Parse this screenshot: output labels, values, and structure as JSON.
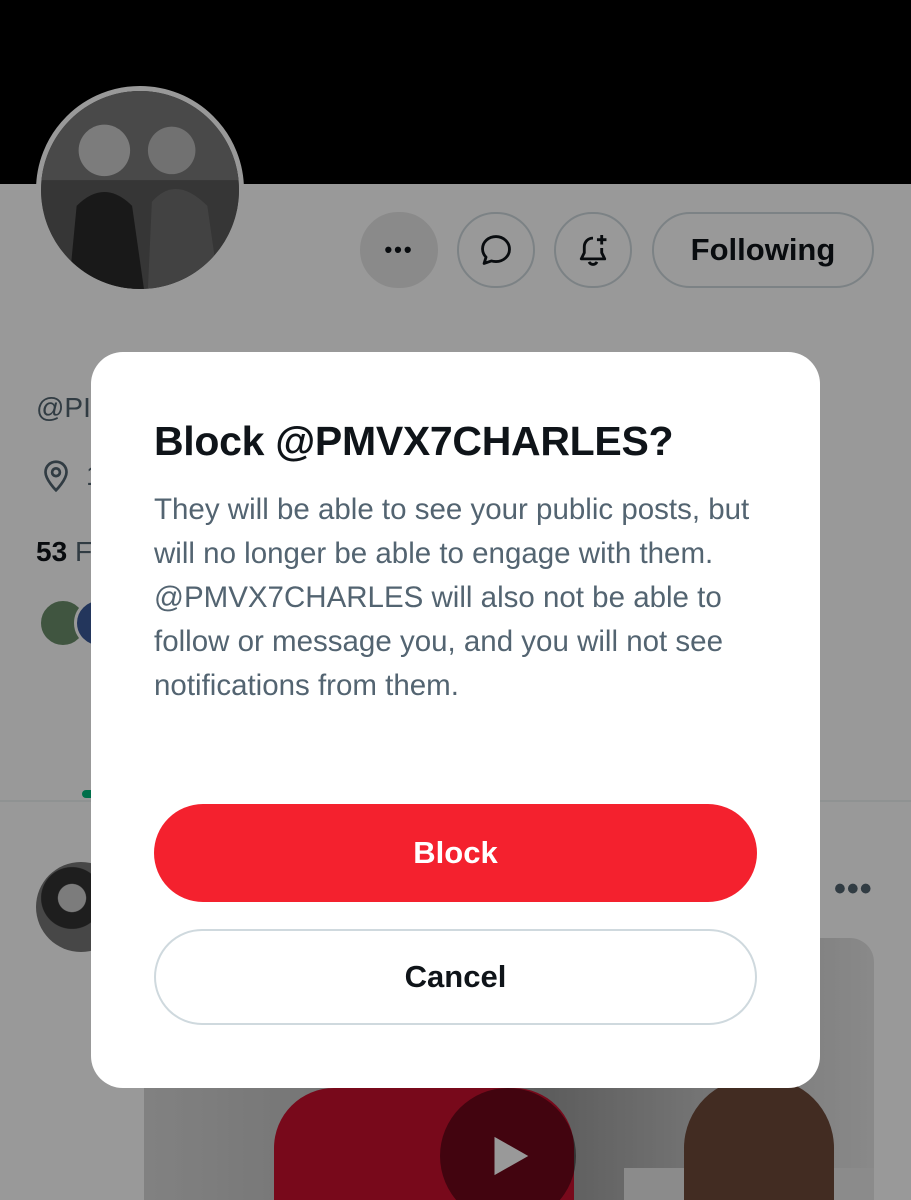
{
  "profile": {
    "following_label": "Following",
    "handle_partial": "@PI",
    "location_partial": "1",
    "stats_count": "53",
    "stats_label_partial": "F",
    "more_dots": "•••"
  },
  "post": {
    "more_dots": "•••"
  },
  "dialog": {
    "title": "Block @PMVX7CHARLES?",
    "body": "They will be able to see your public posts, but will no longer be able to engage with them. @PMVX7CHARLES will also not be able to follow or message you, and you will not see notifications from them.",
    "confirm_label": "Block",
    "cancel_label": "Cancel"
  },
  "colors": {
    "danger": "#f4212e",
    "text_primary": "#0f1419",
    "text_secondary": "#536471",
    "border": "#cfd9de"
  },
  "icons": {
    "more": "more-icon",
    "message": "message-icon",
    "notify": "bell-plus-icon",
    "location": "location-pin-icon",
    "play": "play-icon"
  }
}
